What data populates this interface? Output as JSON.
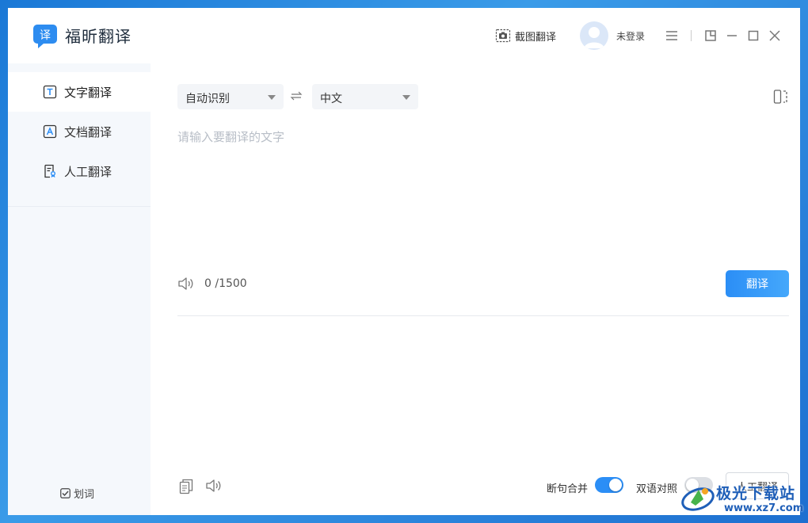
{
  "app": {
    "title": "福昕翻译"
  },
  "header": {
    "screenshot_translate_label": "截图翻译",
    "login_status": "未登录"
  },
  "sidebar": {
    "items": [
      {
        "label": "文字翻译",
        "icon": "text-translate-icon",
        "active": true
      },
      {
        "label": "文档翻译",
        "icon": "document-translate-icon",
        "active": false
      },
      {
        "label": "人工翻译",
        "icon": "human-translate-icon",
        "active": false
      }
    ],
    "select_word_label": "划词"
  },
  "main": {
    "source_lang": "自动识别",
    "target_lang": "中文",
    "input": {
      "value": "",
      "placeholder": "请输入要翻译的文字"
    },
    "counter": "0 /1500",
    "translate_label": "翻译",
    "merge_sentences": {
      "label": "断句合并",
      "on": true
    },
    "bilingual": {
      "label": "双语对照",
      "on": false
    },
    "human_translate_label": "人工翻译"
  },
  "watermark": {
    "main": "极光下载站",
    "sub": "www.xz7.com"
  },
  "colors": {
    "accent": "#2b8ef6",
    "sidebar_bg": "#f5f8fc",
    "toggle_off": "#dcdfe4"
  }
}
